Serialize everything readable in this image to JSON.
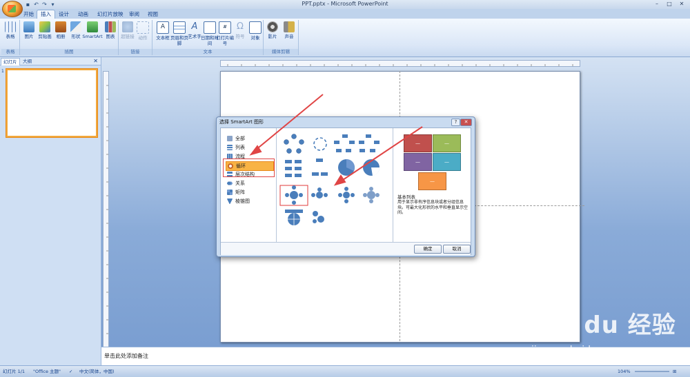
{
  "window": {
    "title": "PPT.pptx - Microsoft PowerPoint",
    "controls": [
      "–",
      "□",
      "✕"
    ]
  },
  "tabs": [
    "开始",
    "插入",
    "设计",
    "动画",
    "幻灯片放映",
    "审阅",
    "视图"
  ],
  "active_tab": "插入",
  "ribbon": {
    "groups": [
      {
        "label": "表格",
        "buttons": [
          "表格"
        ]
      },
      {
        "label": "插图",
        "buttons": [
          "图片",
          "剪贴画",
          "相册",
          "形状",
          "SmartArt",
          "图表"
        ]
      },
      {
        "label": "链接",
        "buttons": [
          "超链接",
          "动作"
        ]
      },
      {
        "label": "文本",
        "buttons": [
          "文本框",
          "页眉和页脚",
          "艺术字",
          "日期和时间",
          "幻灯片编号",
          "符号",
          "对象"
        ]
      },
      {
        "label": "媒体剪辑",
        "buttons": [
          "影片",
          "声音"
        ]
      }
    ]
  },
  "left_pane": {
    "tabs": [
      "幻灯片",
      "大纲"
    ],
    "close": "✕",
    "slide_number": "1"
  },
  "notes": {
    "placeholder": "单击此处添加备注"
  },
  "status": {
    "slide": "幻灯片 1/1",
    "theme": "\"Office 主题\"",
    "language": "中文(简体，中国)",
    "zoom": "104%"
  },
  "dialog": {
    "title": "选择 SmartArt 图形",
    "help": "?",
    "close": "✕",
    "categories": [
      "全部",
      "列表",
      "流程",
      "循环",
      "层次结构",
      "关系",
      "矩阵",
      "棱锥图"
    ],
    "selected_category": "循环",
    "preview_label": "—",
    "description_title": "基本列表",
    "description_text": "用于显示非有序信息块或者分组信息块。可最大化形状的水平和垂直显示空间。",
    "ok": "确定",
    "cancel": "取消"
  },
  "watermark": {
    "brand": "Bai du 经验",
    "url": "jingyan.baidu.com"
  },
  "colors": {
    "accent_orange": "#f8b345",
    "annotation_red": "#e04545",
    "preview_red": "#c0504d",
    "preview_green": "#9bbb59",
    "preview_purple": "#8064a2",
    "preview_teal": "#4bacc6",
    "preview_orange": "#f79646"
  }
}
